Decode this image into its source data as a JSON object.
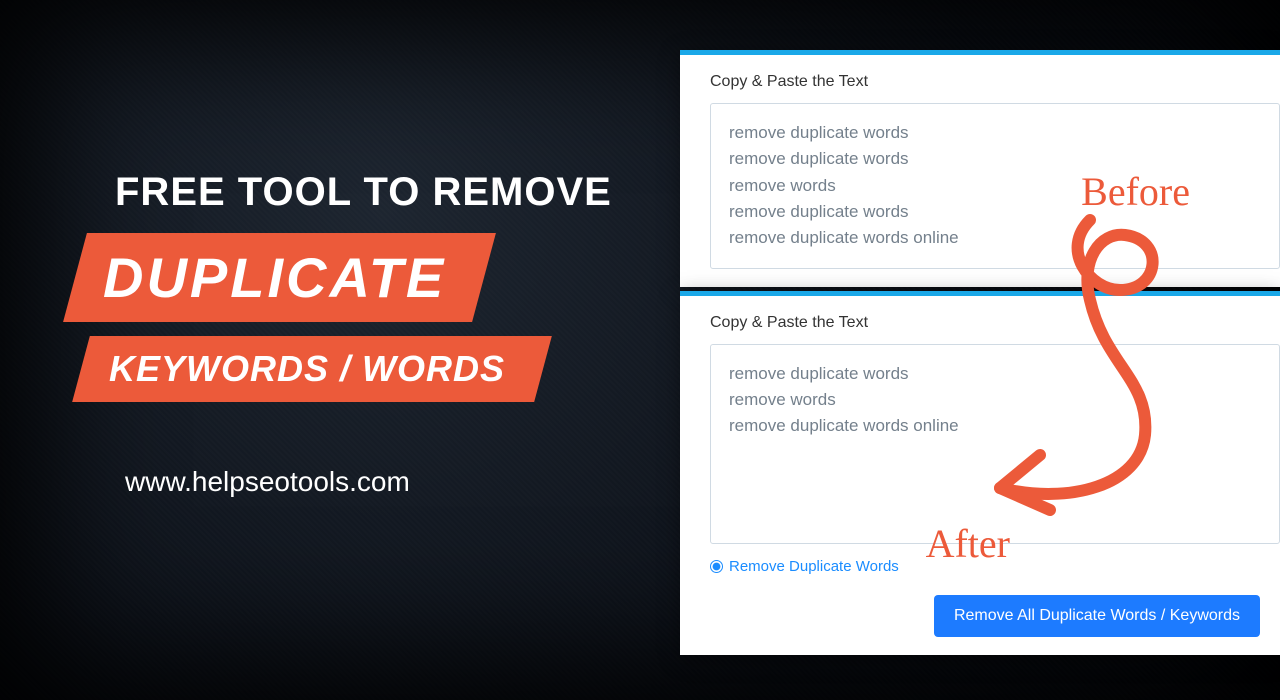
{
  "hero": {
    "line1": "FREE TOOL TO REMOVE",
    "badge1": "DUPLICATE",
    "badge2": "KEYWORDS / WORDS",
    "url": "www.helpseotools.com"
  },
  "before_card": {
    "label": "Copy & Paste the Text",
    "lines": [
      "remove duplicate words",
      "remove duplicate words",
      "remove words",
      "remove duplicate words",
      "remove duplicate words online"
    ]
  },
  "after_card": {
    "label": "Copy & Paste the Text",
    "lines": [
      "remove duplicate words",
      "remove words",
      "remove duplicate words online"
    ],
    "radio_label": "Remove Duplicate Words",
    "button_label": "Remove All Duplicate Words / Keywords"
  },
  "annotations": {
    "before": "Before",
    "after": "After"
  },
  "colors": {
    "accent": "#ec5a3a",
    "button": "#1d7bff",
    "card_border": "#1aa8e8"
  }
}
